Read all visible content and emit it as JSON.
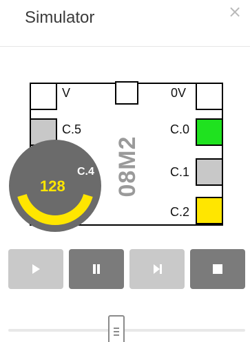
{
  "header": {
    "title": "Simulator",
    "close_glyph": "×"
  },
  "chip": {
    "name": "08M2",
    "labels": {
      "v": "V",
      "zero_v": "0V",
      "c5": "C.5",
      "c4": "C.4",
      "c0": "C.0",
      "c1": "C.1",
      "c2": "C.2"
    },
    "pin_states": {
      "c0": "on",
      "c1": "off",
      "c2": "active",
      "c5": "off"
    },
    "colors": {
      "pin_off": "#c8c8c8",
      "pin_on": "#1fe21f",
      "pin_active": "#ffe600"
    }
  },
  "dial": {
    "pin": "C.4",
    "value": "128",
    "level_fraction": 0.5,
    "colors": {
      "background": "#6b6b6b",
      "arc": "#ffe600",
      "label": "#ffffff"
    }
  },
  "controls": {
    "buttons": [
      {
        "id": "run",
        "icon": "play-icon",
        "enabled": false
      },
      {
        "id": "pause",
        "icon": "pause-icon",
        "enabled": true
      },
      {
        "id": "step",
        "icon": "step-icon",
        "enabled": false
      },
      {
        "id": "stop",
        "icon": "stop-icon",
        "enabled": true
      }
    ],
    "colors": {
      "enabled": "#7b7b7b",
      "disabled": "#c9c9c9"
    }
  },
  "speed_slider": {
    "value_fraction": 0.5
  }
}
